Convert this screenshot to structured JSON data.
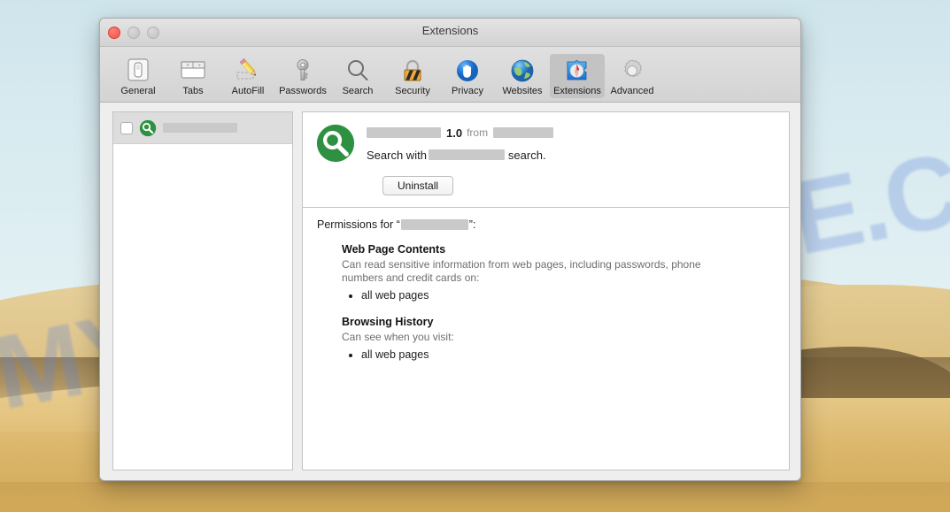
{
  "desktop": {
    "watermark": "MYANTISPYWARE.COM"
  },
  "window": {
    "title": "Extensions",
    "traffic_lights": {
      "close": "close-button",
      "minimize": "minimize-button",
      "zoom": "zoom-button"
    }
  },
  "toolbar": {
    "items": [
      {
        "label": "General",
        "icon": "general-icon",
        "selected": false
      },
      {
        "label": "Tabs",
        "icon": "tabs-icon",
        "selected": false
      },
      {
        "label": "AutoFill",
        "icon": "autofill-icon",
        "selected": false
      },
      {
        "label": "Passwords",
        "icon": "passwords-icon",
        "selected": false
      },
      {
        "label": "Search",
        "icon": "search-icon",
        "selected": false
      },
      {
        "label": "Security",
        "icon": "security-icon",
        "selected": false
      },
      {
        "label": "Privacy",
        "icon": "privacy-icon",
        "selected": false
      },
      {
        "label": "Websites",
        "icon": "websites-icon",
        "selected": false
      },
      {
        "label": "Extensions",
        "icon": "extensions-icon",
        "selected": true
      },
      {
        "label": "Advanced",
        "icon": "advanced-icon",
        "selected": false
      }
    ]
  },
  "extension_list": {
    "items": [
      {
        "enabled": false,
        "icon": "green-magnifier-icon",
        "name_redacted": true,
        "name": ""
      }
    ]
  },
  "detail": {
    "icon": "green-magnifier-icon",
    "name": "",
    "name_redacted": true,
    "version": "1.0",
    "from_label": "from",
    "author": "",
    "author_redacted": true,
    "description_prefix": "Search with",
    "description_suffix": "search.",
    "description_redacted": true,
    "uninstall_label": "Uninstall"
  },
  "permissions": {
    "heading_prefix": "Permissions for “",
    "heading_suffix": "”:",
    "name_redacted": true,
    "groups": [
      {
        "title": "Web Page Contents",
        "description": "Can read sensitive information from web pages, including passwords, phone numbers and credit cards on:",
        "items": [
          "all web pages"
        ]
      },
      {
        "title": "Browsing History",
        "description": "Can see when you visit:",
        "items": [
          "all web pages"
        ]
      }
    ]
  },
  "colors": {
    "accent_green": "#2e9142",
    "window_chrome": "#e0e0e0",
    "selected_tab": "#c3c3c3",
    "redaction_gray": "#c9c9c9",
    "watermark_blue": "#6084d6",
    "close_red": "#f4524a"
  }
}
